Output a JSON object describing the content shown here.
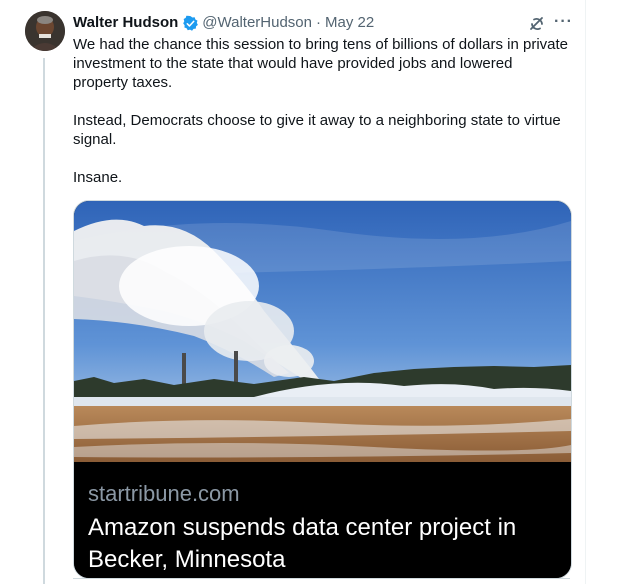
{
  "tweet": {
    "author_name": "Walter Hudson",
    "handle": "@WalterHudson",
    "separator": "·",
    "date": "May 22",
    "paragraphs": [
      "We had the chance this session to bring tens of billions of dollars in private investment to the state that would have provided jobs and lowered property taxes.",
      "Instead, Democrats choose to give it away to a neighboring state to virtue signal.",
      "Insane."
    ],
    "more_glyph": "···"
  },
  "link_card": {
    "domain": "startribune.com",
    "headline": "Amazon suspends data center project in Becker, Minnesota"
  },
  "icons": {
    "verified": "verified-badge-icon",
    "grok": "grok-icon",
    "more": "more-icon"
  },
  "colors": {
    "verified": "#1d9bf0",
    "secondary_text": "#536471",
    "primary_text": "#0f1419",
    "card_caption_bg": "#000000",
    "card_domain": "#8b98a5"
  }
}
